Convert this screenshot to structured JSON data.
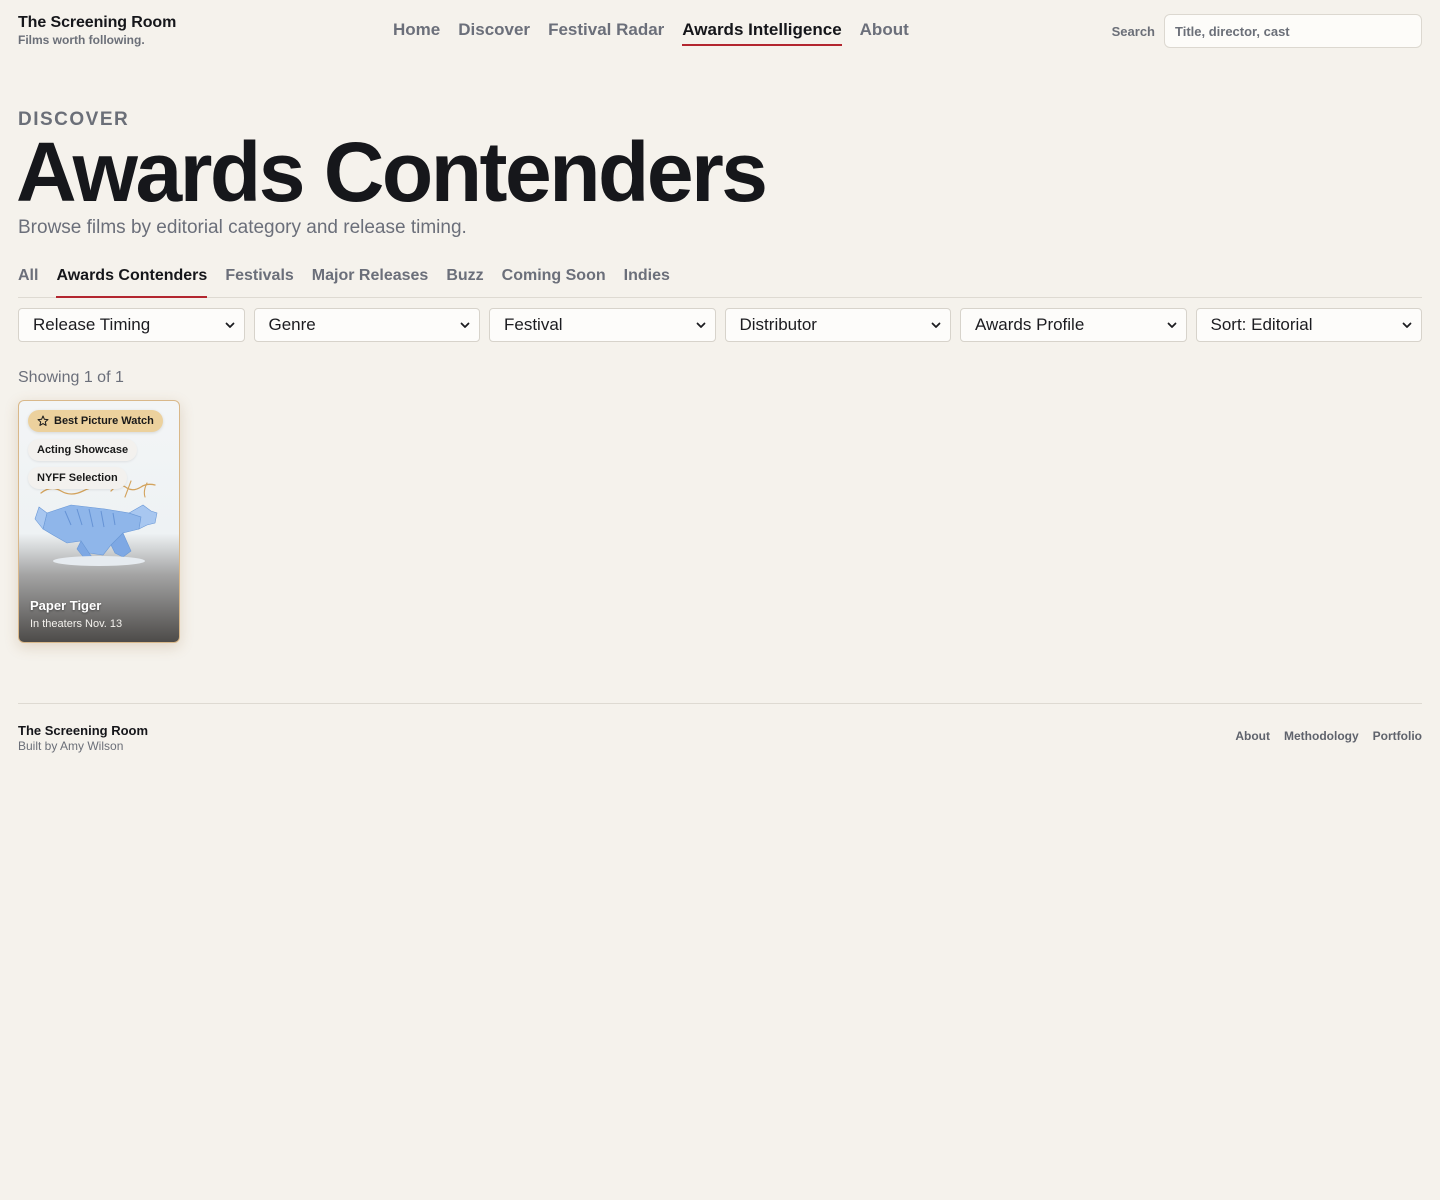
{
  "header": {
    "brand_title": "The Screening Room",
    "brand_tagline": "Films worth following.",
    "nav": [
      "Home",
      "Discover",
      "Festival Radar",
      "Awards Intelligence",
      "About"
    ],
    "active_nav": "Awards Intelligence",
    "search_label": "Search",
    "search_placeholder": "Title, director, cast"
  },
  "hero": {
    "eyebrow": "DISCOVER",
    "title": "Awards Contenders",
    "subtitle": "Browse films by editorial category and release timing."
  },
  "category_tabs": [
    "All",
    "Awards Contenders",
    "Festivals",
    "Major Releases",
    "Buzz",
    "Coming Soon",
    "Indies"
  ],
  "active_tab": "Awards Contenders",
  "filters": [
    "Release Timing",
    "Genre",
    "Festival",
    "Distributor",
    "Awards Profile",
    "Sort: Editorial"
  ],
  "results_count": "Showing 1 of 1",
  "films": [
    {
      "title": "Paper Tiger",
      "release": "In theaters Nov. 13",
      "badges": [
        "Best Picture Watch",
        "Acting Showcase",
        "NYFF Selection"
      ],
      "icon": "star-icon"
    }
  ],
  "footer": {
    "brand": "The Screening Room",
    "credit": "Built by Amy Wilson",
    "links": [
      "About",
      "Methodology",
      "Portfolio"
    ]
  },
  "colors": {
    "accent": "#b3262f",
    "background": "#f5f2ec",
    "badge_gold": "#ecd19d",
    "card_border": "#d9b88a"
  }
}
